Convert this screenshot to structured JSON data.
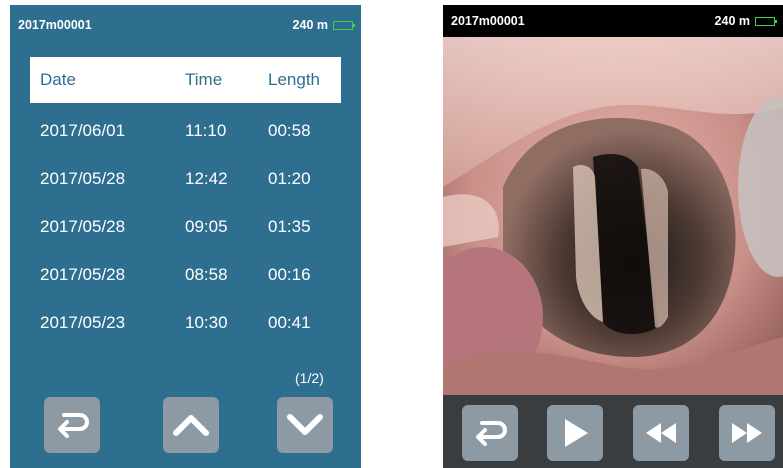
{
  "left_screen": {
    "status": {
      "device_id": "2017m00001",
      "distance": "240 m",
      "battery_level": 0.9,
      "battery_color": "#3fd34a"
    },
    "header": {
      "date": "Date",
      "time": "Time",
      "length": "Length"
    },
    "recordings": [
      {
        "date": "2017/06/01",
        "time": "11:10",
        "length": "00:58"
      },
      {
        "date": "2017/05/28",
        "time": "12:42",
        "length": "01:20"
      },
      {
        "date": "2017/05/28",
        "time": "09:05",
        "length": "01:35"
      },
      {
        "date": "2017/05/28",
        "time": "08:58",
        "length": "00:16"
      },
      {
        "date": "2017/05/23",
        "time": "10:30",
        "length": "00:41"
      }
    ],
    "page_indicator": "(1/2)",
    "buttons": [
      "back-icon",
      "chevron-up-icon",
      "chevron-down-icon"
    ],
    "accent_color": "#2e6f90"
  },
  "right_screen": {
    "status": {
      "device_id": "2017m00001",
      "distance": "240 m",
      "battery_level": 0.9
    },
    "buttons": [
      "back-icon",
      "play-icon",
      "rewind-icon",
      "fast-forward-icon"
    ]
  }
}
